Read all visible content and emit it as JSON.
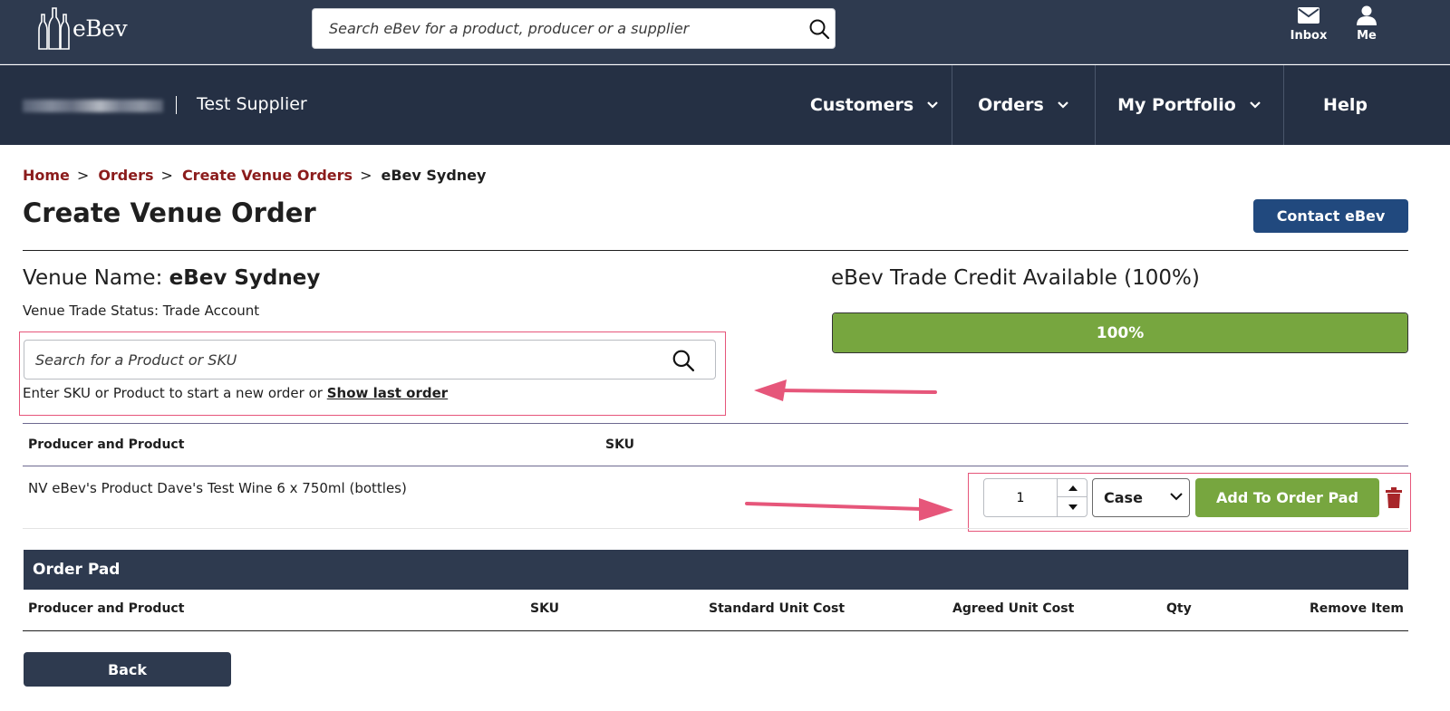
{
  "header": {
    "logo_text": "eBev",
    "search_placeholder": "Search eBev for a product, producer or a supplier",
    "inbox_label": "Inbox",
    "me_label": "Me"
  },
  "nav": {
    "supplier_name": "Test Supplier",
    "items": [
      {
        "label": "Customers"
      },
      {
        "label": "Orders"
      },
      {
        "label": "My Portfolio"
      },
      {
        "label": "Help"
      }
    ]
  },
  "breadcrumb": {
    "home": "Home",
    "orders": "Orders",
    "create_venue_orders": "Create Venue Orders",
    "current": "eBev Sydney",
    "separator": ">"
  },
  "page": {
    "title": "Create Venue Order",
    "contact_button": "Contact eBev"
  },
  "venue": {
    "name_label": "Venue Name:",
    "name_value": "eBev Sydney",
    "trade_status": "Venue Trade Status: Trade Account"
  },
  "product_search": {
    "placeholder": "Search for a Product or SKU",
    "hint_text": "Enter SKU or Product to start a new order or",
    "show_last_order": "Show last order"
  },
  "credit": {
    "title": "eBev Trade Credit Available (100%)",
    "percent": 100,
    "bar_label": "100%",
    "bar_color": "#77a63f"
  },
  "results_table": {
    "columns": [
      "Producer and Product",
      "SKU"
    ],
    "rows": [
      {
        "product": "NV eBev's Product Dave's Test Wine 6 x 750ml (bottles)",
        "sku": "",
        "qty": "1",
        "unit": "Case",
        "add_button": "Add To Order Pad"
      }
    ]
  },
  "order_pad": {
    "title": "Order Pad",
    "columns": [
      "Producer and Product",
      "SKU",
      "Standard Unit Cost",
      "Agreed Unit Cost",
      "Qty",
      "Remove Item"
    ]
  },
  "footer": {
    "back_button": "Back"
  },
  "colors": {
    "top_bar": "#2e3a4f",
    "nav_bar": "#253044",
    "accent_red": "#8b1c1c",
    "contact_blue": "#21497e",
    "green": "#77a63f",
    "annotation_pink": "#e6567a"
  }
}
